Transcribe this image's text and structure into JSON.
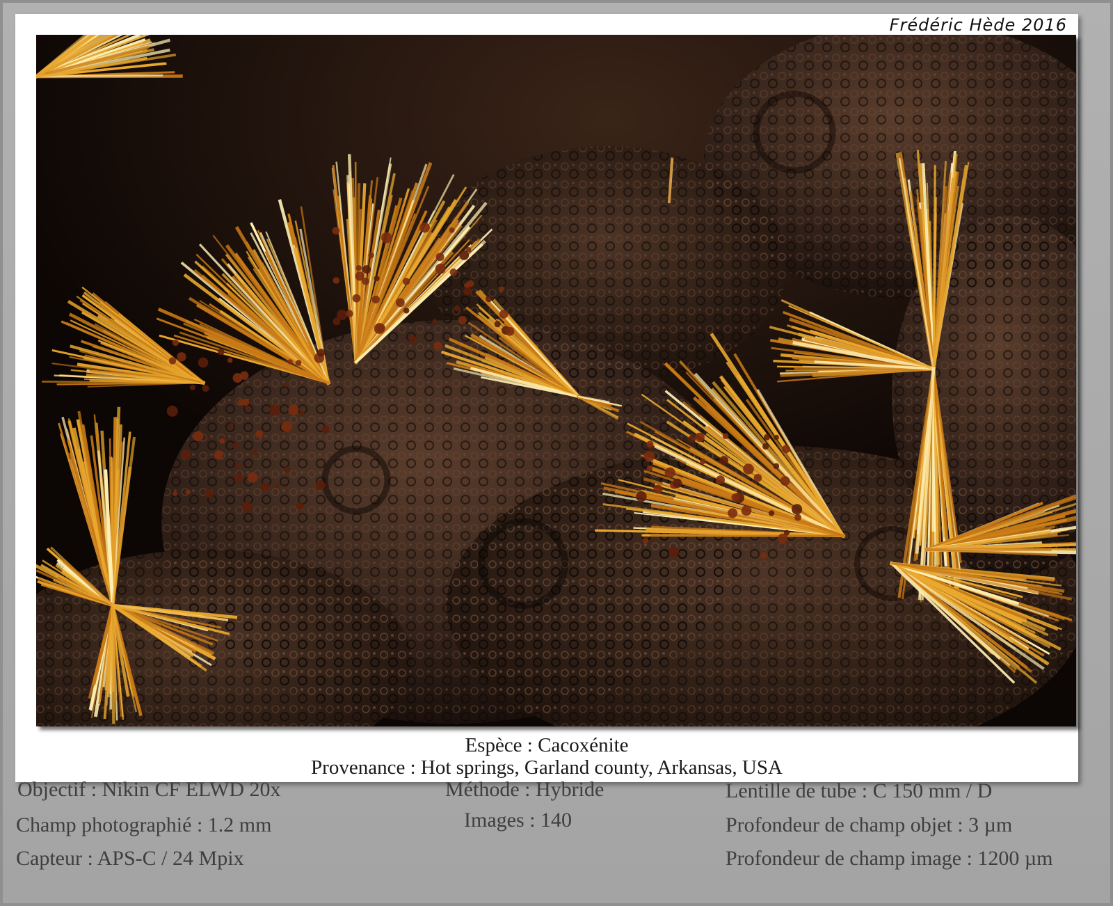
{
  "signature": "Frédéric Hède 2016",
  "caption": {
    "species": "Espèce : Cacoxénite",
    "origin": "Provenance : Hot springs, Garland county, Arkansas, USA"
  },
  "details": {
    "left": {
      "objective": "Objectif : Nikin CF ELWD 20x",
      "field": "Champ photographié : 1.2 mm",
      "sensor": "Capteur : APS-C / 24 Mpix"
    },
    "middle": {
      "method": "Méthode : Hybride",
      "images": "Images : 140"
    },
    "right": {
      "tube_lens": "Lentille de tube : C 150 mm / D",
      "depth_object": "Profondeur de champ objet : 3 µm",
      "depth_image": "Profondeur de champ image : 1200 µm"
    }
  },
  "photo": {
    "subject": "cacoxenite crystal sprays on dark rock",
    "colors": {
      "rock": "#2a1a12",
      "crystal": "#e6a62a",
      "highlight": "#fde08a",
      "background": "#120905"
    }
  }
}
